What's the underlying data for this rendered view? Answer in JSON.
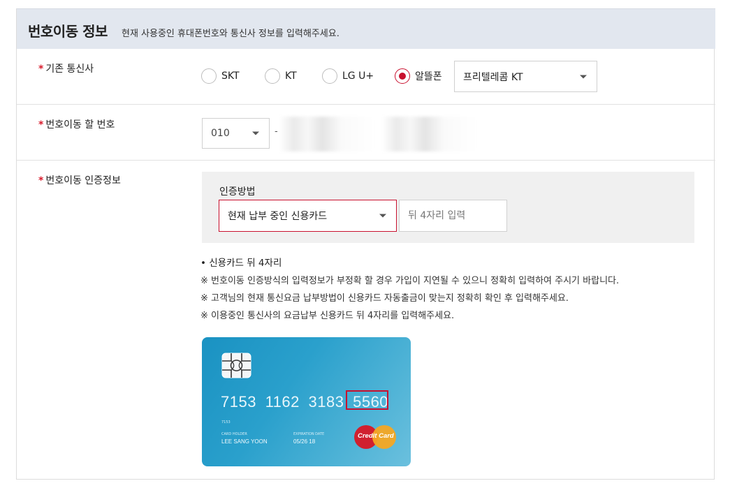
{
  "header": {
    "title": "번호이동 정보",
    "subtitle": "현재 사용중인 휴대폰번호와 통신사 정보를 입력해주세요."
  },
  "carrier": {
    "label": "기존 통신사",
    "required_mark": "*",
    "options": [
      "SKT",
      "KT",
      "LG U+",
      "알뜰폰"
    ],
    "selected": "알뜰폰",
    "mvno_select_value": "프리텔레콤 KT"
  },
  "port_number": {
    "label": "번호이동 할 번호",
    "required_mark": "*",
    "prefix": "010",
    "separator": "-"
  },
  "auth": {
    "label": "번호이동 인증정보",
    "required_mark": "*",
    "method_title": "인증방법",
    "method_value": "현재 납부 중인 신용카드",
    "digits_placeholder": "뒤 4자리 입력",
    "notes": [
      "• 신용카드 뒤 4자리",
      "※ 번호이동 인증방식의 입력정보가 부정확 할 경우 가입이 지연될 수 있으니 정확히 입력하여 주시기 바랍니다.",
      "※ 고객님의 현재 통신요금 납부방법이 신용카드 자동출금이 맞는지 정확히 확인 후 입력해주세요.",
      "※ 이용중인 통신사의 요금납부 신용카드 뒤 4자리를 입력해주세요."
    ]
  },
  "card": {
    "number_groups": [
      "7153",
      "1162",
      "3183",
      "5560"
    ],
    "small_code": "7153",
    "holder_caption": "CARD HOLDER",
    "holder_name": "LEE SANG YOON",
    "expiration_caption": "EXPIRATION DATE",
    "expiration": "05/26 18",
    "brand": "Credit Card"
  },
  "colors": {
    "accent": "#c8102e",
    "header_bg": "#e2e7ef",
    "auth_box_bg": "#f0f0f0"
  }
}
